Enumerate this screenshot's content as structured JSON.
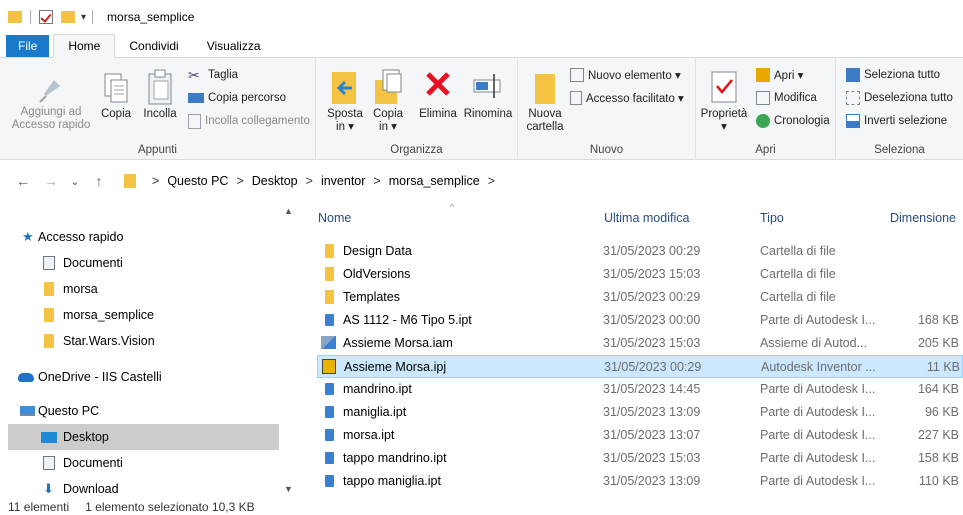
{
  "window": {
    "title": "morsa_semplice"
  },
  "tabs": [
    "File",
    "Home",
    "Condividi",
    "Visualizza"
  ],
  "ribbon": {
    "appunti": {
      "label": "Appunti",
      "aggiungi": "Aggiungi ad\nAccesso rapido",
      "copia": "Copia",
      "incolla": "Incolla",
      "taglia": "Taglia",
      "copia_percorso": "Copia percorso",
      "incolla_collegamento": "Incolla collegamento"
    },
    "organizza": {
      "label": "Organizza",
      "sposta": "Sposta\nin ▾",
      "copia": "Copia\nin ▾",
      "elimina": "Elimina",
      "rinomina": "Rinomina"
    },
    "nuovo": {
      "label": "Nuovo",
      "nuova_cartella": "Nuova\ncartella",
      "nuovo_elemento": "Nuovo elemento ▾",
      "accesso_facilitato": "Accesso facilitato ▾"
    },
    "apri": {
      "label": "Apri",
      "proprieta": "Proprietà\n▾",
      "apri": "Apri ▾",
      "modifica": "Modifica",
      "cronologia": "Cronologia"
    },
    "seleziona": {
      "label": "Seleziona",
      "tutto": "Seleziona tutto",
      "nessuno": "Deseleziona tutto",
      "inverti": "Inverti selezione"
    }
  },
  "address": {
    "back": "←",
    "forward": "→",
    "recent": "⌄",
    "up": "↑",
    "crumbs": [
      "Questo PC",
      "Desktop",
      "inventor",
      "morsa_semplice"
    ],
    "sep": ">"
  },
  "navpane": {
    "items": [
      {
        "label": "Accesso rapido",
        "icon": "star-icon"
      },
      {
        "label": "Documenti",
        "icon": "document-icon"
      },
      {
        "label": "morsa",
        "icon": "folder-icon"
      },
      {
        "label": "morsa_semplice",
        "icon": "folder-icon"
      },
      {
        "label": "Star.Wars.Vision",
        "icon": "folder-icon"
      },
      {
        "label": "OneDrive - IIS Castelli",
        "icon": "cloud-icon"
      },
      {
        "label": "Questo PC",
        "icon": "pc-icon"
      },
      {
        "label": "Desktop",
        "icon": "desktop-icon"
      },
      {
        "label": "Documenti",
        "icon": "document-icon"
      },
      {
        "label": "Download",
        "icon": "download-icon"
      }
    ]
  },
  "columns": [
    "Nome",
    "Ultima modifica",
    "Tipo",
    "Dimensione"
  ],
  "files": [
    {
      "name": "Design Data",
      "date": "31/05/2023 00:29",
      "type": "Cartella di file",
      "size": "",
      "icon": "folder-icon"
    },
    {
      "name": "OldVersions",
      "date": "31/05/2023 15:03",
      "type": "Cartella di file",
      "size": "",
      "icon": "folder-icon"
    },
    {
      "name": "Templates",
      "date": "31/05/2023 00:29",
      "type": "Cartella di file",
      "size": "",
      "icon": "folder-icon"
    },
    {
      "name": "AS 1112 - M6  Tipo 5.ipt",
      "date": "31/05/2023 00:00",
      "type": "Parte di Autodesk I...",
      "size": "168 KB",
      "icon": "part-icon"
    },
    {
      "name": "Assieme Morsa.iam",
      "date": "31/05/2023 15:03",
      "type": "Assieme di Autod...",
      "size": "205 KB",
      "icon": "assembly-icon"
    },
    {
      "name": "Assieme Morsa.ipj",
      "date": "31/05/2023 00:29",
      "type": "Autodesk Inventor ...",
      "size": "11 KB",
      "icon": "project-icon"
    },
    {
      "name": "mandrino.ipt",
      "date": "31/05/2023 14:45",
      "type": "Parte di Autodesk I...",
      "size": "164 KB",
      "icon": "part-icon"
    },
    {
      "name": "maniglia.ipt",
      "date": "31/05/2023 13:09",
      "type": "Parte di Autodesk I...",
      "size": "96 KB",
      "icon": "part-icon"
    },
    {
      "name": "morsa.ipt",
      "date": "31/05/2023 13:07",
      "type": "Parte di Autodesk I...",
      "size": "227 KB",
      "icon": "part-icon"
    },
    {
      "name": "tappo mandrino.ipt",
      "date": "31/05/2023 15:03",
      "type": "Parte di Autodesk I...",
      "size": "158 KB",
      "icon": "part-icon"
    },
    {
      "name": "tappo maniglia.ipt",
      "date": "31/05/2023 13:09",
      "type": "Parte di Autodesk I...",
      "size": "110 KB",
      "icon": "part-icon"
    }
  ],
  "status": {
    "count": "11 elementi",
    "selected": "1 elemento selezionato  10,3 KB"
  },
  "colors": {
    "file_tab": "#1979ca",
    "selection": "#cce8ff",
    "folder": "#f5c342"
  }
}
